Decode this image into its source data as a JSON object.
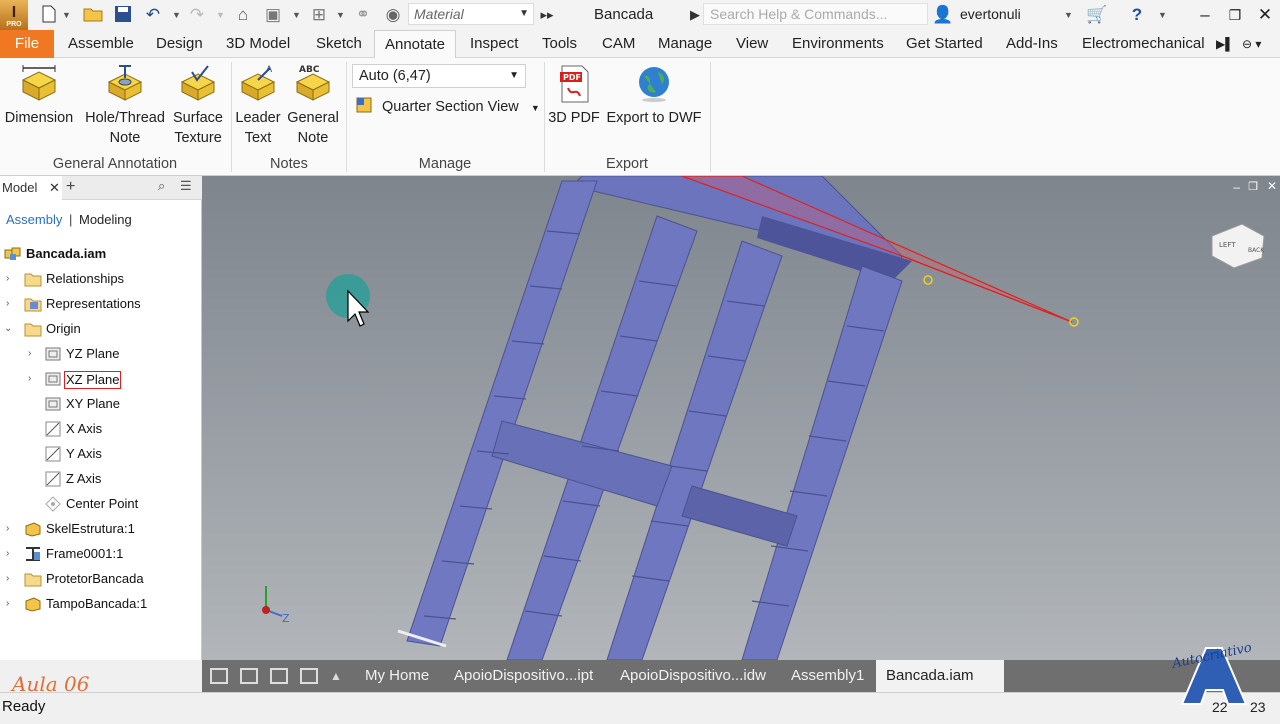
{
  "titlebar": {
    "app_logo": "I",
    "app_logo_sub": "PRO",
    "material_value": "Material",
    "document_title": "Bancada",
    "search_placeholder": "Search Help & Commands...",
    "user_name": "evertonuli",
    "icons": [
      "new-icon",
      "open-icon",
      "save-icon",
      "undo-icon",
      "redo-icon",
      "home-icon",
      "image-icon",
      "select-icon",
      "measure-icon",
      "appearance-icon",
      "forward-icon",
      "user-icon",
      "cart-icon",
      "help-icon",
      "minimize-icon",
      "restore-icon",
      "close-icon"
    ]
  },
  "tabs": {
    "file": "File",
    "items": [
      "Assemble",
      "Design",
      "3D Model",
      "Sketch",
      "Annotate",
      "Inspect",
      "Tools",
      "CAM",
      "Manage",
      "View",
      "Environments",
      "Get Started",
      "Add-Ins",
      "Electromechanical"
    ],
    "active": "Annotate"
  },
  "ribbon": {
    "general_annotation": {
      "label": "General Annotation",
      "dimension": "Dimension",
      "hole_note_1": "Hole/Thread",
      "hole_note_2": "Note",
      "surface_1": "Surface",
      "surface_2": "Texture"
    },
    "notes": {
      "label": "Notes",
      "leader_1": "Leader",
      "leader_2": "Text",
      "general_1": "General",
      "general_2": "Note"
    },
    "manage": {
      "label": "Manage",
      "select_value": "Auto (6,47)",
      "quarter_section": "Quarter Section View"
    },
    "export": {
      "label": "Export",
      "pdf": "3D PDF",
      "dwf": "Export to DWF",
      "pdf_icon_text": "PDF"
    }
  },
  "browser": {
    "tab_label": "Model",
    "mode_assembly": "Assembly",
    "mode_modeling": "Modeling",
    "tree": [
      {
        "label": "Bancada.iam",
        "icon": "assembly-icon"
      },
      {
        "label": "Relationships",
        "icon": "folder-icon"
      },
      {
        "label": "Representations",
        "icon": "representations-icon"
      },
      {
        "label": "Origin",
        "icon": "folder-icon"
      },
      {
        "label": "YZ Plane",
        "icon": "plane-icon"
      },
      {
        "label": "XZ Plane",
        "icon": "plane-icon"
      },
      {
        "label": "XY Plane",
        "icon": "plane-icon"
      },
      {
        "label": "X Axis",
        "icon": "axis-icon"
      },
      {
        "label": "Y Axis",
        "icon": "axis-icon"
      },
      {
        "label": "Z Axis",
        "icon": "axis-icon"
      },
      {
        "label": "Center Point",
        "icon": "point-icon"
      },
      {
        "label": "SkelEstrutura:1",
        "icon": "part-icon"
      },
      {
        "label": "Frame0001:1",
        "icon": "frame-icon"
      },
      {
        "label": "ProtetorBancada",
        "icon": "folder-icon"
      },
      {
        "label": "TampoBancada:1",
        "icon": "part-icon"
      }
    ],
    "selected": "XZ Plane"
  },
  "viewport": {
    "view_cube_left": "LEFT",
    "view_cube_back": "BACK",
    "triad_z": "Z"
  },
  "doc_tabs": {
    "items": [
      "My Home",
      "ApoioDispositivo...ipt",
      "ApoioDispositivo...idw",
      "Assembly1",
      "Bancada.iam"
    ],
    "active": "Bancada.iam"
  },
  "status": {
    "text": "Ready",
    "num1": "22",
    "num2": "23"
  },
  "watermark": {
    "lesson": "Aula 06",
    "brand": "Autocriativo"
  },
  "colors": {
    "file_tab": "#f07822",
    "frame_blue": "#6f78c0",
    "selection_red": "#e02020"
  }
}
